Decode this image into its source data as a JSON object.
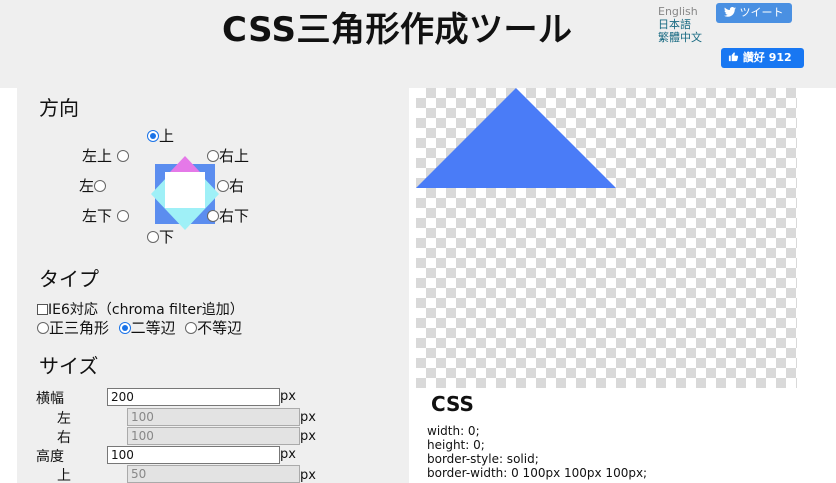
{
  "header": {
    "title": "CSS三角形作成ツール",
    "languages": {
      "english": "English",
      "japanese": "日本語",
      "chinese": "繁體中文"
    },
    "tweet_label": "ツイート",
    "like_label": "讚好",
    "like_count": "912"
  },
  "direction": {
    "heading": "方向",
    "options": {
      "up": "上",
      "upper_left": "左上",
      "upper_right": "右上",
      "left": "左",
      "right": "右",
      "lower_left": "左下",
      "lower_right": "右下",
      "down": "下"
    },
    "selected": "up"
  },
  "type": {
    "heading": "タイプ",
    "ie6_label": "IE6対応（chroma filter追加）",
    "ie6_checked": false,
    "options": {
      "equilateral": "正三角形",
      "isosceles": "二等辺",
      "scalene": "不等辺"
    },
    "selected": "isosceles"
  },
  "size": {
    "heading": "サイズ",
    "width_label": "横幅",
    "width_value": "200",
    "left_label": "左",
    "left_value": "100",
    "right_label": "右",
    "right_value": "100",
    "height_label": "高度",
    "height_value": "100",
    "top_label": "上",
    "top_value": "50",
    "unit": "px"
  },
  "preview": {
    "color": "#4a7cf7"
  },
  "css": {
    "heading": "CSS",
    "lines": [
      "width: 0;",
      "height: 0;",
      "border-style: solid;",
      "border-width: 0 100px 100px 100px;"
    ]
  }
}
